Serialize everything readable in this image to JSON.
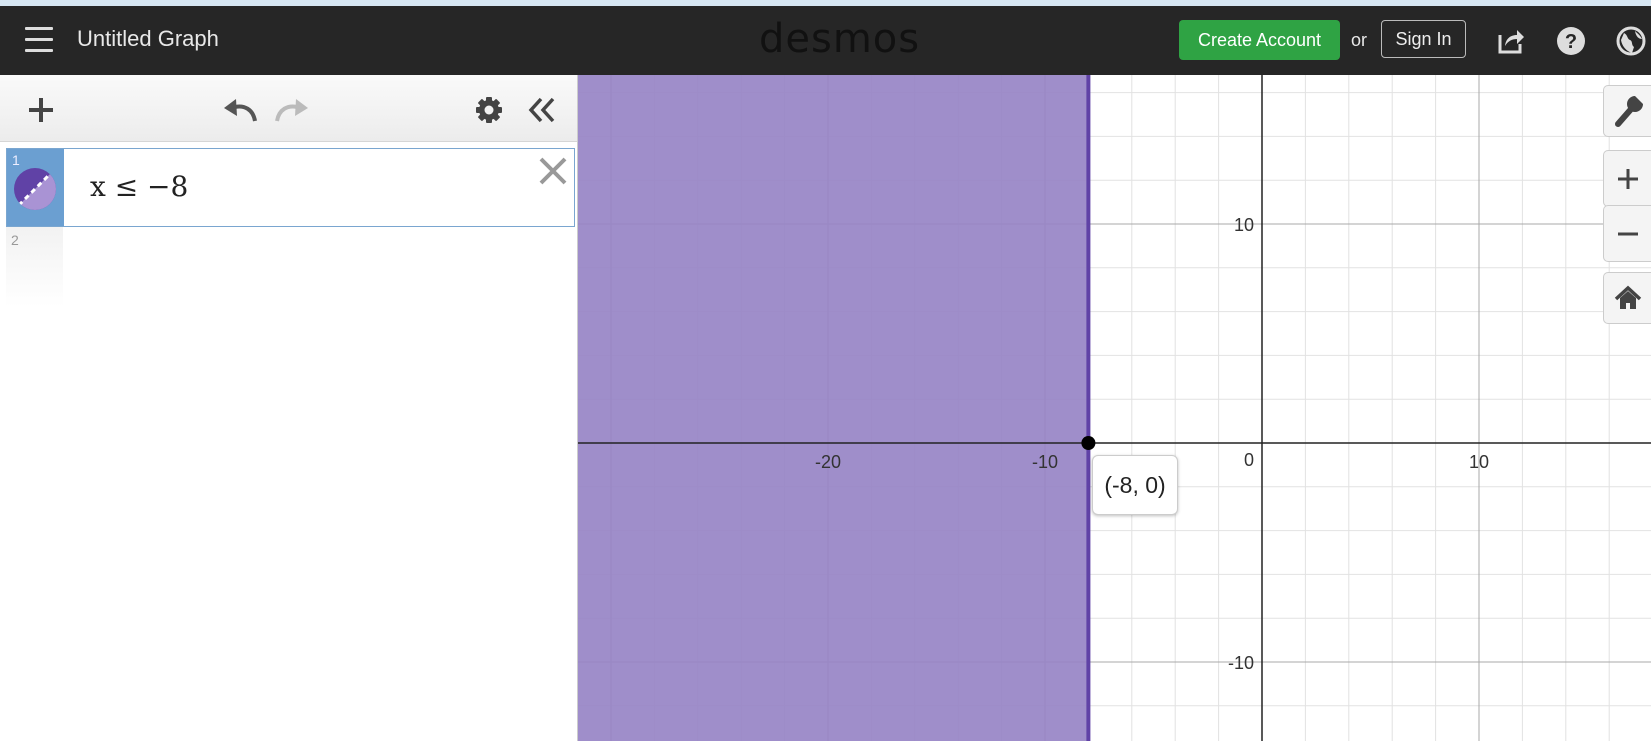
{
  "header": {
    "title": "Untitled Graph",
    "logo": "desmos",
    "create_account": "Create Account",
    "or": "or",
    "sign_in": "Sign In",
    "icons": [
      "menu-icon",
      "share-icon",
      "help-icon",
      "globe-icon"
    ]
  },
  "expressions": [
    {
      "index": "1",
      "latex": "x ≤ −8",
      "color": "#6042a6"
    },
    {
      "index": "2",
      "latex": ""
    }
  ],
  "graph": {
    "x_ticks": [
      "-20",
      "-10",
      "0",
      "10"
    ],
    "y_ticks": [
      "10",
      "-10"
    ],
    "shade_color": "#9784c6",
    "boundary_color": "#6042a6",
    "point_label": "(-8, 0)"
  }
}
